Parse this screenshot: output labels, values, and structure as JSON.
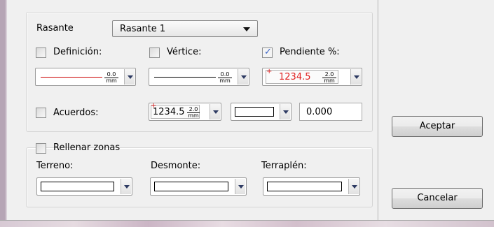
{
  "rasante": {
    "label": "Rasante",
    "selected": "Rasante 1"
  },
  "definicion": {
    "label": "Definición:",
    "checked": false,
    "line_color": "#cc0000",
    "thickness": "0.0",
    "unit": "mm"
  },
  "vertice": {
    "label": "Vértice:",
    "checked": false,
    "line_color": "#000000",
    "thickness": "0.0",
    "unit": "mm"
  },
  "pendiente": {
    "label": "Pendiente %:",
    "checked": true,
    "sample_text": "1234.5",
    "text_color": "#e02020",
    "size": "2.0",
    "unit": "mm"
  },
  "acuerdos": {
    "label": "Acuerdos:",
    "checked": false,
    "sample_text": "1234.5",
    "size": "2.0",
    "unit": "mm",
    "value": "0.000"
  },
  "rellenar": {
    "label": "Rellenar zonas",
    "checked": false,
    "terreno_label": "Terreno:",
    "desmonte_label": "Desmonte:",
    "terraplen_label": "Terraplén:"
  },
  "buttons": {
    "accept": "Aceptar",
    "cancel": "Cancelar"
  }
}
